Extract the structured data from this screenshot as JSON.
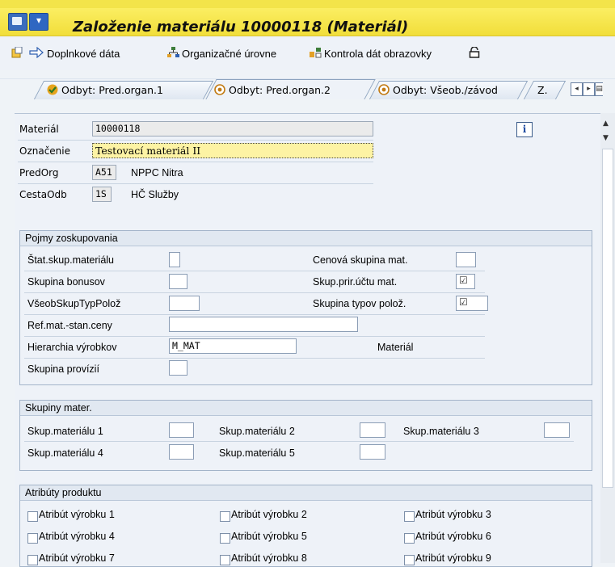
{
  "title": "Založenie materiálu 10000118 (Materiál)",
  "toolbar": {
    "additional_data": "Doplnkové dáta",
    "org_levels": "Organizačné úrovne",
    "check_screen_data": "Kontrola dát obrazovky"
  },
  "tabs": [
    {
      "label": "Odbyt: Pred.organ.1"
    },
    {
      "label": "Odbyt: Pred.organ.2"
    },
    {
      "label": "Odbyt: Všeob./závod"
    },
    {
      "label": "Z."
    }
  ],
  "header": {
    "material_label": "Materiál",
    "material_value": "10000118",
    "description_label": "Označenie",
    "description_value": "Testovací materiál II",
    "salesorg_label": "PredOrg",
    "salesorg_value": "A51",
    "salesorg_text": "NPPC Nitra",
    "distchannel_label": "CestaOdb",
    "distchannel_value": "1S",
    "distchannel_text": "HČ Služby"
  },
  "grouping": {
    "title": "Pojmy zoskupovania",
    "stat_group_label": "Štat.skup.materiálu",
    "price_group_label": "Cenová skupina mat.",
    "bonus_group_label": "Skupina bonusov",
    "acct_assign_label": "Skup.prir.účtu mat.",
    "gen_item_cat_label": "VšeobSkupTypPolož",
    "item_cat_group_label": "Skupina typov polož.",
    "price_ref_label": "Ref.mat.-stan.ceny",
    "hierarchy_label": "Hierarchia výrobkov",
    "hierarchy_value": "M_MAT",
    "hierarchy_text": "Materiál",
    "commission_label": "Skupina provízií"
  },
  "material_groups": {
    "title": "Skupiny mater.",
    "g1": "Skup.materiálu 1",
    "g2": "Skup.materiálu 2",
    "g3": "Skup.materiálu 3",
    "g4": "Skup.materiálu 4",
    "g5": "Skup.materiálu 5"
  },
  "attributes": {
    "title": "Atribúty produktu",
    "a1": "Atribút výrobku 1",
    "a2": "Atribút výrobku 2",
    "a3": "Atribút výrobku 3",
    "a4": "Atribút výrobku 4",
    "a5": "Atribút výrobku 5",
    "a6": "Atribút výrobku 6",
    "a7": "Atribút výrobku 7",
    "a8": "Atribút výrobku 8",
    "a9": "Atribút výrobku 9"
  }
}
